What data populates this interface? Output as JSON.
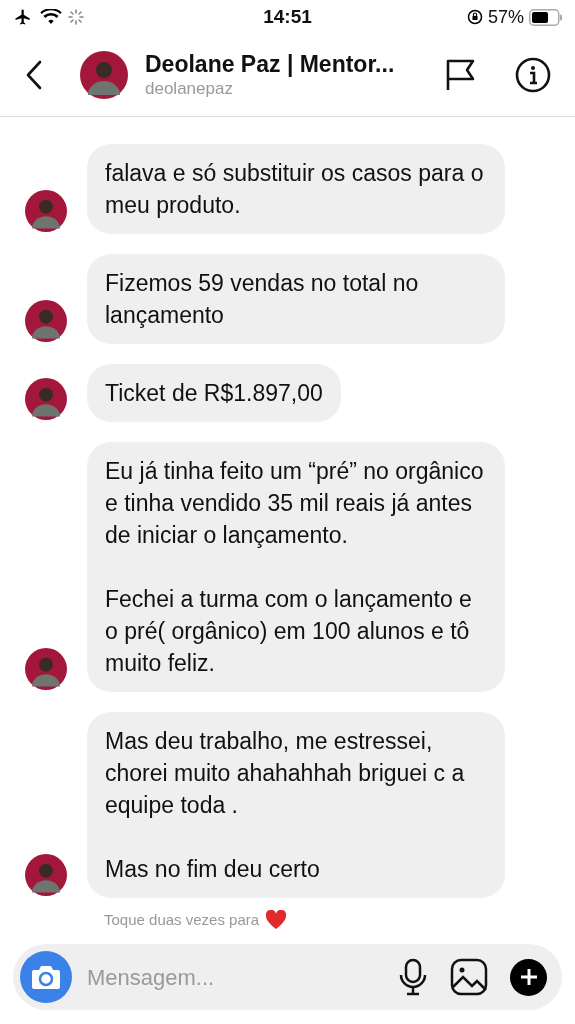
{
  "status_bar": {
    "time": "14:51",
    "battery": "57%"
  },
  "header": {
    "name": "Deolane Paz | Mentor...",
    "username": "deolanepaz"
  },
  "messages": [
    {
      "paragraphs": [
        "falava e só substituir os casos para o meu produto."
      ]
    },
    {
      "paragraphs": [
        "Fizemos 59 vendas no total no lançamento"
      ]
    },
    {
      "paragraphs": [
        "Ticket de R$1.897,00"
      ]
    },
    {
      "paragraphs": [
        "Eu já tinha feito um “pré” no orgânico e tinha vendido 35 mil reais já antes de iniciar o lançamento.",
        "Fechei a turma com o lançamento e o pré( orgânico) em 100 alunos e tô muito feliz."
      ]
    },
    {
      "paragraphs": [
        "Mas deu trabalho, me estressei, chorei muito ahahahhah briguei c a equipe toda .",
        "Mas no fim deu certo"
      ]
    }
  ],
  "hint": "Toque duas vezes para",
  "composer": {
    "placeholder": "Mensagem..."
  }
}
